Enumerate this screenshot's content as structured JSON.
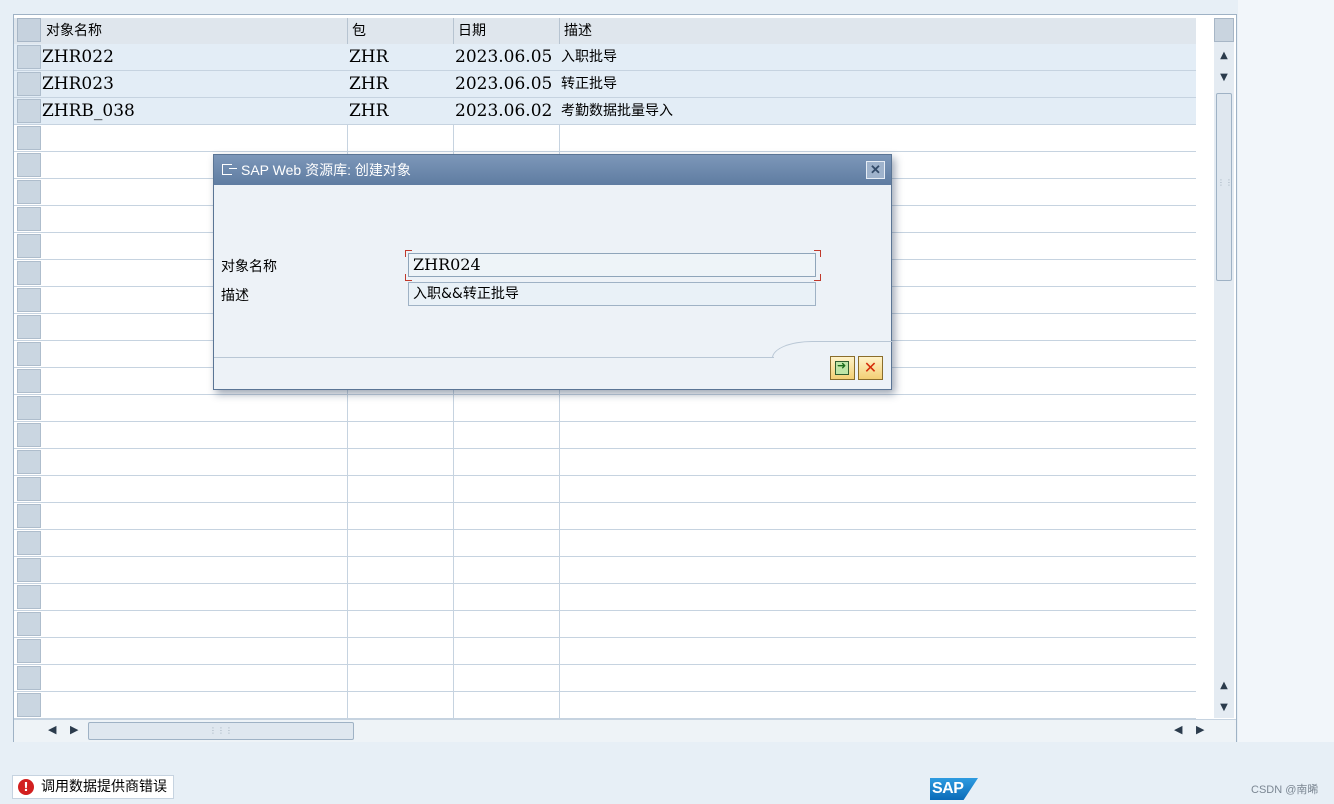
{
  "table": {
    "columns": [
      "对象名称",
      "包",
      "日期",
      "描述"
    ],
    "rows": [
      {
        "name": "ZHR022",
        "package": "ZHR",
        "date": "2023.06.05",
        "desc": "入职批导"
      },
      {
        "name": "ZHR023",
        "package": "ZHR",
        "date": "2023.06.05",
        "desc": "转正批导"
      },
      {
        "name": "ZHRB_038",
        "package": "ZHR",
        "date": "2023.06.02",
        "desc": "考勤数据批量导入"
      }
    ]
  },
  "dialog": {
    "title": "SAP Web 资源库: 创建对象",
    "name_label": "对象名称",
    "name_value": "ZHR024",
    "desc_label": "描述",
    "desc_value": "入职&&转正批导"
  },
  "icons": {
    "close": "close-icon",
    "ok": "continue-icon",
    "cancel": "cancel-icon",
    "error": "error-icon"
  },
  "status": {
    "message": "调用数据提供商错误"
  },
  "logo": "SAP",
  "watermark": "CSDN @南晞",
  "colors": {
    "title_bar": "#6983a8",
    "error": "#d21f1f",
    "cancel": "#d42c0a"
  }
}
